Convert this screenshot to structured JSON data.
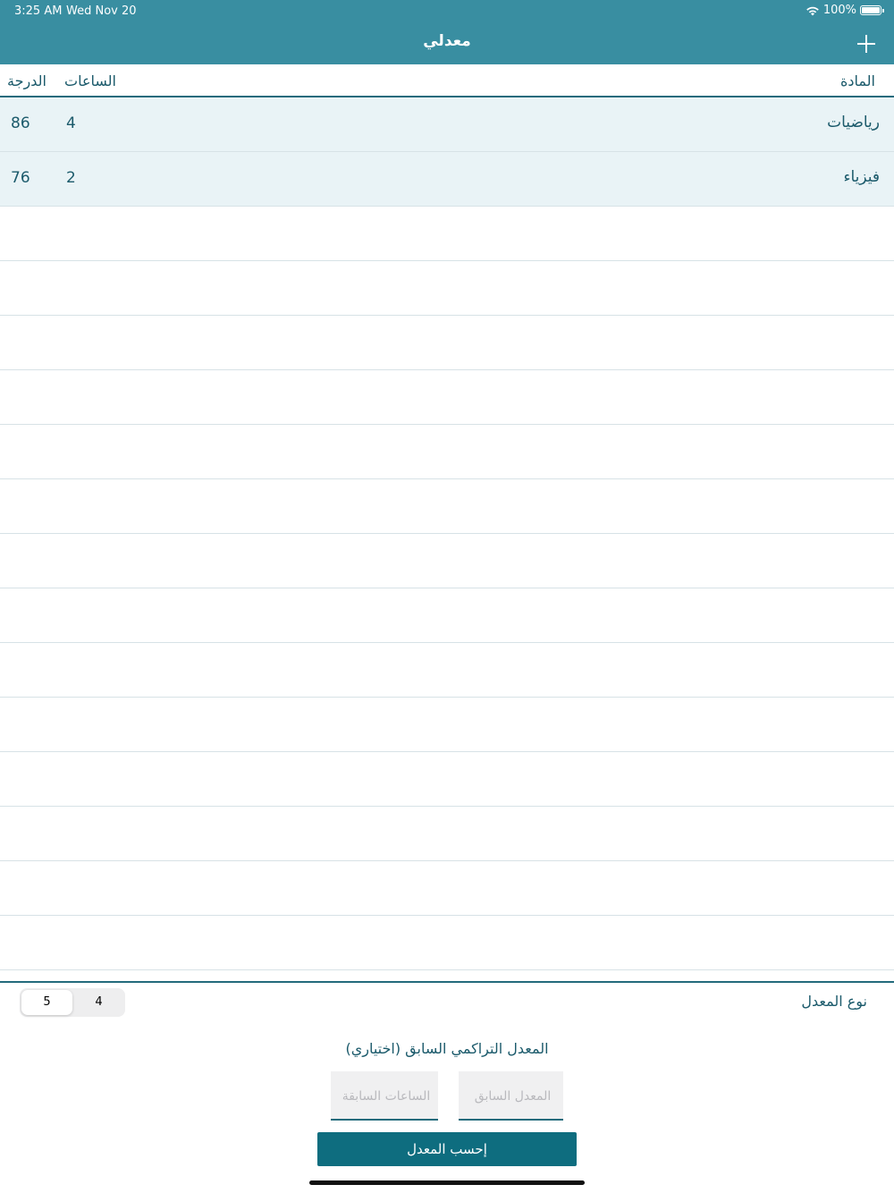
{
  "status": {
    "time": "3:25 AM",
    "date": "Wed Nov 20",
    "battery": "100%"
  },
  "nav": {
    "title": "معدلي",
    "add_icon": "plus-icon"
  },
  "table": {
    "headers": {
      "subject": "المادة",
      "hours": "الساعات",
      "grade": "الدرجة"
    },
    "rows": [
      {
        "subject": "رياضيات",
        "hours": "4",
        "grade": "86"
      },
      {
        "subject": "فيزياء",
        "hours": "2",
        "grade": "76"
      }
    ]
  },
  "gpa_type": {
    "label": "نوع المعدل",
    "options": [
      "5",
      "4"
    ],
    "selected": "5"
  },
  "previous": {
    "label": "المعدل التراكمي السابق (اختياري)",
    "gpa_placeholder": "المعدل السابق",
    "hours_placeholder": "الساعات السابقة"
  },
  "calculate_label": "إحسب المعدل",
  "colors": {
    "nav": "#398ea1",
    "accent": "#0e6d7f",
    "row_fill": "#e9f3f6",
    "text": "#1b5a6b"
  }
}
